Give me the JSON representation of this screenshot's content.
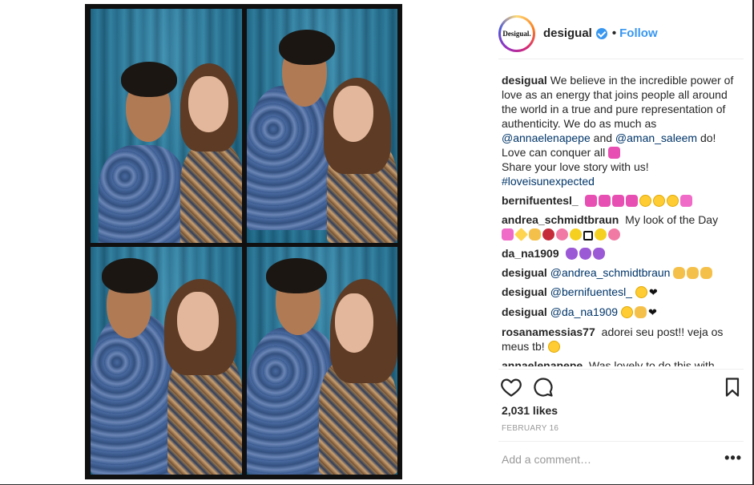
{
  "post": {
    "username": "desigual",
    "avatar_text": "Desigual.",
    "follow_label": "Follow",
    "separator": "•"
  },
  "caption": {
    "username": "desigual",
    "text_1": "We believe in the incredible power of love as an energy that joins people all around the world in a true and pure representation of authenticity. We do as much as ",
    "mention_1": "@annaelenapepe",
    "text_2": " and ",
    "mention_2": "@aman_saleem",
    "text_3": " do! Love can conquer all ",
    "text_4": "Share your love story with us! ",
    "hashtag": "#loveisunexpected"
  },
  "comments": [
    {
      "username": "bernifuentesl_",
      "text": ""
    },
    {
      "username": "andrea_schmidtbraun",
      "text": "My look of the Day"
    },
    {
      "username": "da_na1909",
      "text": ""
    },
    {
      "username": "desigual",
      "mention": "@andrea_schmidtbraun",
      "text": ""
    },
    {
      "username": "desigual",
      "mention": "@bernifuentesl_",
      "text": ""
    },
    {
      "username": "desigual",
      "mention": "@da_na1909",
      "text": ""
    },
    {
      "username": "rosanamessias77",
      "text": "adorei seu post!! veja os meus tb!"
    },
    {
      "username": "annaelenapepe",
      "text": "Was lovely to do this with"
    }
  ],
  "stats": {
    "likes": "2,031 likes",
    "date": "FEBRUARY 16"
  },
  "add_comment": {
    "placeholder": "Add a comment…",
    "more_label": "•••"
  },
  "icons": [
    "heart-icon",
    "comment-icon",
    "bookmark-icon",
    "verified-icon",
    "more-icon"
  ],
  "colors": {
    "link": "#003569",
    "follow": "#3897f0",
    "text": "#262626",
    "muted": "#999999"
  }
}
